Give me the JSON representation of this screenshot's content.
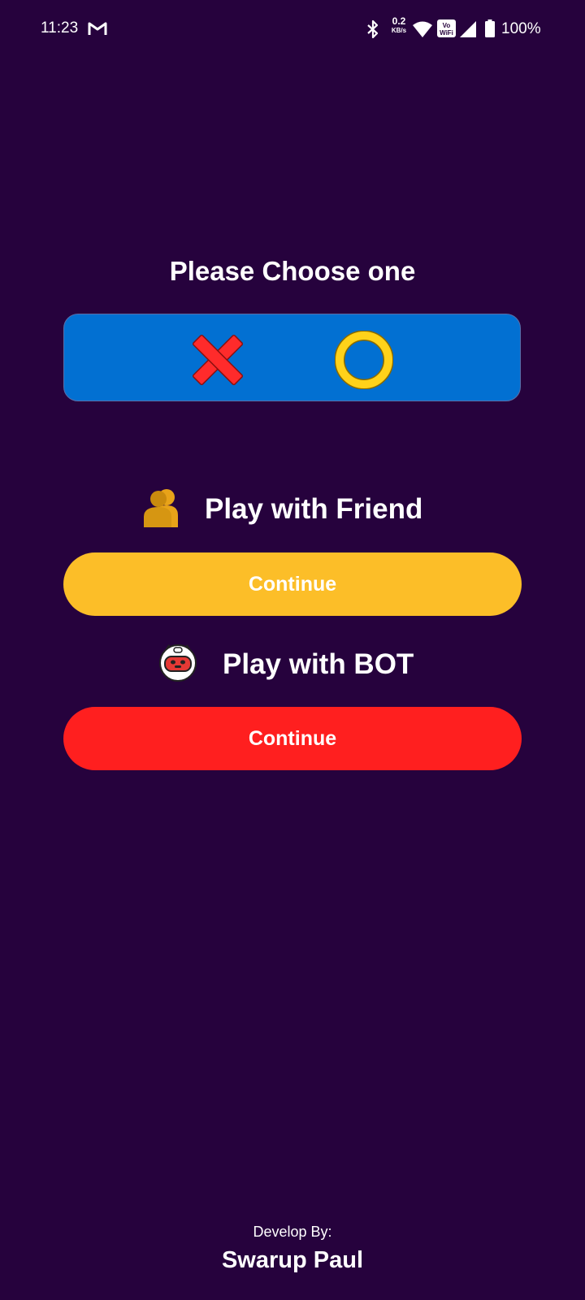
{
  "status_bar": {
    "time": "11:23",
    "net_speed_value": "0.2",
    "net_speed_unit": "KB/s",
    "vowifi_top": "Vo",
    "vowifi_bottom": "WiFi",
    "battery": "100%",
    "icons": [
      "gmail-icon",
      "bluetooth-icon",
      "wifi-icon",
      "vowifi-icon",
      "signal-icon",
      "battery-icon"
    ]
  },
  "choose": {
    "title": "Please Choose one",
    "options": [
      "x-symbol",
      "o-symbol"
    ]
  },
  "modes": {
    "friend": {
      "label": "Play with Friend",
      "button": "Continue",
      "icon": "friends-icon"
    },
    "bot": {
      "label": "Play with BOT",
      "button": "Continue",
      "icon": "robot-icon"
    }
  },
  "footer": {
    "develop_by": "Develop By:",
    "developer": "Swarup Paul"
  },
  "colors": {
    "background": "#26023d",
    "choice_card": "#0270d2",
    "x_mark": "#ff2b2b",
    "o_mark": "#ffd21a",
    "friend_button": "#fcbe28",
    "bot_button": "#ff1f1f",
    "text": "#ffffff"
  }
}
